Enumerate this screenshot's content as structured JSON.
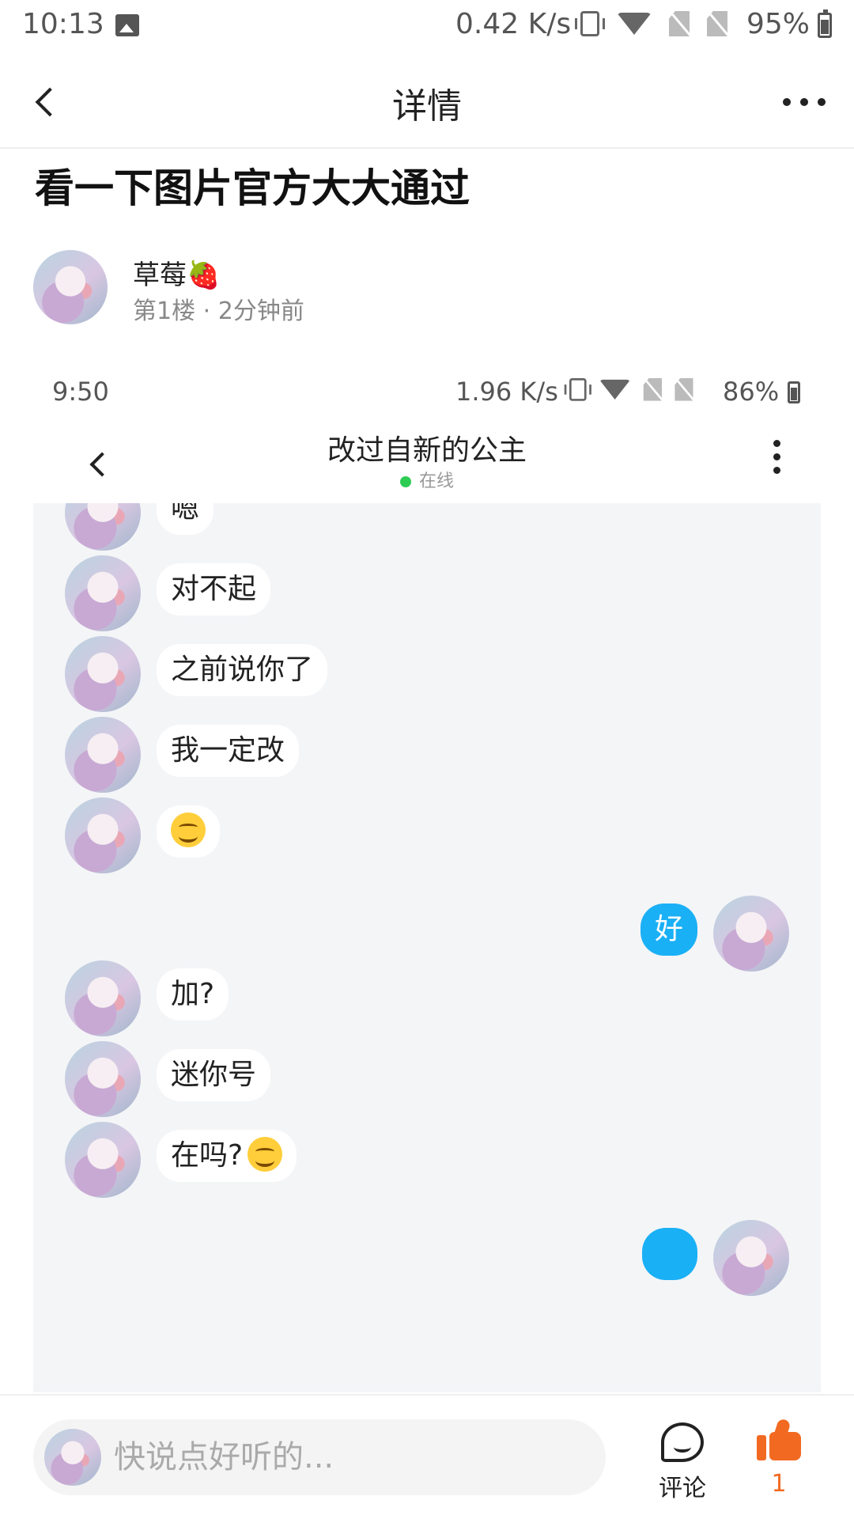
{
  "status_bar": {
    "time": "10:13",
    "net_speed": "0.42 K/s",
    "battery": "95%"
  },
  "header": {
    "title": "详情"
  },
  "post": {
    "title": "看一下图片官方大大通过",
    "author": "草莓🍓",
    "floor": "第1楼",
    "separator": "·",
    "time_ago": "2分钟前"
  },
  "screenshot": {
    "status_bar": {
      "time": "9:50",
      "net_speed": "1.96 K/s",
      "battery": "86%"
    },
    "chat": {
      "contact_name": "改过自新的公主",
      "presence": "在线",
      "messages": [
        {
          "side": "left",
          "text": "嗯"
        },
        {
          "side": "left",
          "text": "对不起"
        },
        {
          "side": "left",
          "text": "之前说你了"
        },
        {
          "side": "left",
          "text": "我一定改"
        },
        {
          "side": "left",
          "text": "",
          "emoji": "smiley-icon"
        },
        {
          "side": "right",
          "text": "好"
        },
        {
          "side": "left",
          "text": "加?"
        },
        {
          "side": "left",
          "text": "迷你号"
        },
        {
          "side": "left",
          "text": "在吗?",
          "emoji": "smiley-icon"
        }
      ]
    }
  },
  "bottom_bar": {
    "comment_placeholder": "快说点好听的...",
    "comment_label": "评论",
    "like_count": "1"
  },
  "colors": {
    "accent_blue": "#1ab0f6",
    "like_orange": "#f26a22",
    "online_green": "#2ecc53",
    "chat_background": "#f4f5f7"
  }
}
